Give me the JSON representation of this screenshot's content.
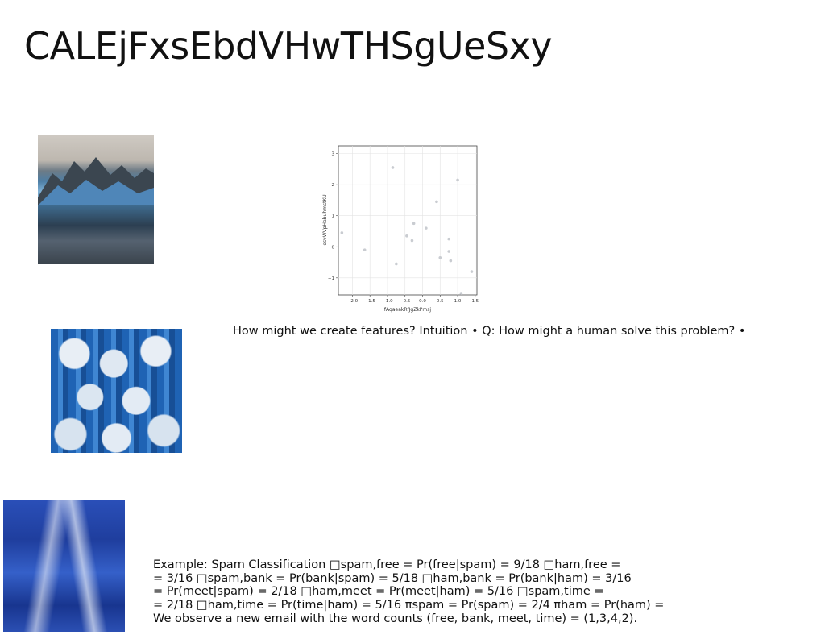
{
  "slide": {
    "title": "CALEjFxsEbdVHwTHSgUeSxy",
    "features_text": "How might we create features? Intuition • Q: How might a human solve this problem? •",
    "example_lines": [
      "Example: Spam Classification □spam,free = Pr(free|spam) = 9/18 □ham,free =",
      "= 3/16 □spam,bank = Pr(bank|spam) = 5/18 □ham,bank = Pr(bank|ham) = 3/16",
      "= Pr(meet|spam) = 2/18 □ham,meet = Pr(meet|ham) = 5/16 □spam,time =",
      "= 2/18 □ham,time = Pr(time|ham) = 5/16 πspam = Pr(spam) = 2/4 πham = Pr(ham) =",
      "We observe a new email with the word counts (free, bank, meet, time) = (1,3,4,2)."
    ]
  },
  "images": {
    "mountain": "mountain-photo",
    "pumpkins": "blue-pumpkins-photo",
    "ice": "blue-ice-photo"
  },
  "chart_data": {
    "type": "scatter",
    "xlabel": "fAqaeakRfJgZkPmsj",
    "ylabel": "osvWVpHabuhmstKU",
    "xlim": [
      -2.4,
      1.55
    ],
    "ylim": [
      -1.55,
      3.25
    ],
    "xticks": [
      -2.0,
      -1.5,
      -1.0,
      -0.5,
      0.0,
      0.5,
      1.0,
      1.5
    ],
    "yticks": [
      -1,
      0,
      1,
      2,
      3
    ],
    "grid": true,
    "point_color": "#c9ccd1",
    "x": [
      -2.3,
      -1.65,
      -0.85,
      -0.75,
      -0.45,
      -0.3,
      -0.25,
      0.1,
      0.4,
      0.5,
      0.75,
      0.75,
      0.8,
      1.0,
      1.1,
      1.4
    ],
    "y": [
      0.45,
      -0.1,
      2.55,
      -0.55,
      0.35,
      0.2,
      0.75,
      0.6,
      1.45,
      -0.35,
      0.25,
      -0.15,
      -0.45,
      2.15,
      -1.5,
      -0.8
    ]
  }
}
